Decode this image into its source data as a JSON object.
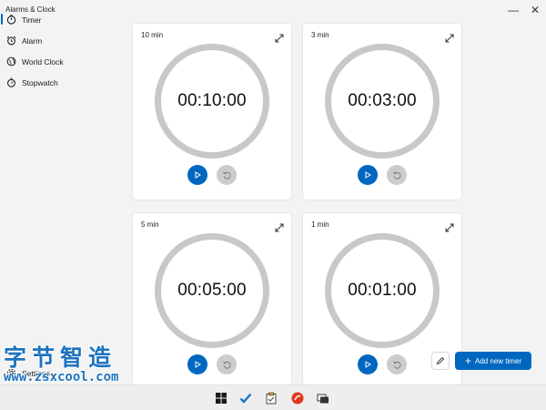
{
  "window": {
    "title": "Alarms & Clock",
    "minimize_symbol": "—",
    "close_symbol": "✕"
  },
  "sidebar": {
    "items": [
      {
        "label": "Timer",
        "icon": "timer-icon",
        "active": true
      },
      {
        "label": "Alarm",
        "icon": "alarm-icon",
        "active": false
      },
      {
        "label": "World Clock",
        "icon": "world-clock-icon",
        "active": false
      },
      {
        "label": "Stopwatch",
        "icon": "stopwatch-icon",
        "active": false
      }
    ],
    "settings_label": "Settings"
  },
  "timers": [
    {
      "name": "10 min",
      "time": "00:10:00"
    },
    {
      "name": "3 min",
      "time": "00:03:00"
    },
    {
      "name": "5 min",
      "time": "00:05:00"
    },
    {
      "name": "1 min",
      "time": "00:01:00"
    }
  ],
  "actions": {
    "add_label": "Add new timer",
    "add_symbol": "+"
  },
  "colors": {
    "accent": "#0067c0",
    "ring": "#c8c8c8",
    "reset_disabled": "#cccccc"
  },
  "taskbar": {
    "icons": [
      "windows-start-icon",
      "checkmark-app-icon",
      "clipboard-app-icon",
      "red-app-icon",
      "window-switch-icon"
    ]
  },
  "watermark": {
    "chinese": "字节智造",
    "url": "www.zsxcool.com"
  }
}
